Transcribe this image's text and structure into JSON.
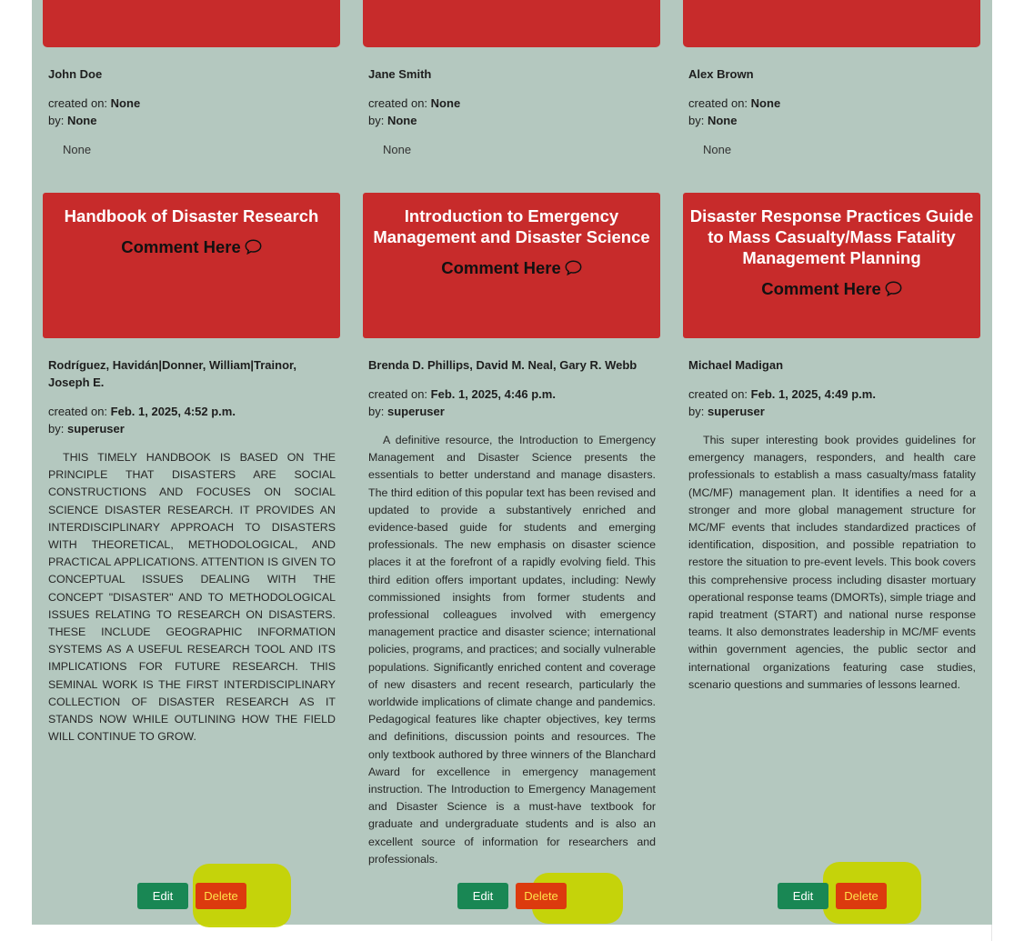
{
  "columns": [
    {
      "top_author": "John Doe",
      "top_created_label": "created on:",
      "top_created_value": "None",
      "top_by_label": "by:",
      "top_by_value": "None",
      "top_desc": "None",
      "title": "Handbook of Disaster Research",
      "comment_label": "Comment Here",
      "author": "Rodríguez, Havidán|Donner, William|Trainor, Joseph E.",
      "created_label": "created on:",
      "created_value": "Feb. 1, 2025, 4:52 p.m.",
      "by_label": "by:",
      "by_value": "superuser",
      "description": "THIS TIMELY HANDBOOK IS BASED ON THE PRINCIPLE THAT DISASTERS ARE SOCIAL CONSTRUCTIONS AND FOCUSES ON SOCIAL SCIENCE DISASTER RESEARCH. IT PROVIDES AN INTERDISCIPLINARY APPROACH TO DISASTERS WITH THEORETICAL, METHODOLOGICAL, AND PRACTICAL APPLICATIONS. ATTENTION IS GIVEN TO CONCEPTUAL ISSUES DEALING WITH THE CONCEPT \"DISASTER\" AND TO METHODOLOGICAL ISSUES RELATING TO RESEARCH ON DISASTERS. THESE INCLUDE GEOGRAPHIC INFORMATION SYSTEMS AS A USEFUL RESEARCH TOOL AND ITS IMPLICATIONS FOR FUTURE RESEARCH. THIS SEMINAL WORK IS THE FIRST INTERDISCIPLINARY COLLECTION OF DISASTER RESEARCH AS IT STANDS NOW WHILE OUTLINING HOW THE FIELD WILL CONTINUE TO GROW.",
      "edit_label": "Edit",
      "delete_label": "Delete"
    },
    {
      "top_author": "Jane Smith",
      "top_created_label": "created on:",
      "top_created_value": "None",
      "top_by_label": "by:",
      "top_by_value": "None",
      "top_desc": "None",
      "title": "Introduction to Emergency Management and Disaster Science",
      "comment_label": "Comment Here",
      "author": "Brenda D. Phillips, David M. Neal, Gary R. Webb",
      "created_label": "created on:",
      "created_value": "Feb. 1, 2025, 4:46 p.m.",
      "by_label": "by:",
      "by_value": "superuser",
      "description": "A definitive resource, the Introduction to Emergency Management and Disaster Science presents the essentials to better understand and manage disasters. The third edition of this popular text has been revised and updated to provide a substantively enriched and evidence-based guide for students and emerging professionals. The new emphasis on disaster science places it at the forefront of a rapidly evolving field. This third edition offers important updates, including: Newly commissioned insights from former students and professional colleagues involved with emergency management practice and disaster science; international policies, programs, and practices; and socially vulnerable populations. Significantly enriched content and coverage of new disasters and recent research, particularly the worldwide implications of climate change and pandemics. Pedagogical features like chapter objectives, key terms and definitions, discussion points and resources. The only textbook authored by three winners of the Blanchard Award for excellence in emergency management instruction. The Introduction to Emergency Management and Disaster Science is a must-have textbook for graduate and undergraduate students and is also an excellent source of information for researchers and professionals.",
      "edit_label": "Edit",
      "delete_label": "Delete"
    },
    {
      "top_author": "Alex Brown",
      "top_created_label": "created on:",
      "top_created_value": "None",
      "top_by_label": "by:",
      "top_by_value": "None",
      "top_desc": "None",
      "title": "Disaster Response Practices Guide to Mass Casualty/Mass Fatality Management Planning",
      "comment_label": "Comment Here",
      "author": "Michael Madigan",
      "created_label": "created on:",
      "created_value": "Feb. 1, 2025, 4:49 p.m.",
      "by_label": "by:",
      "by_value": "superuser",
      "description": "This super interesting book provides guidelines for emergency managers, responders, and health care professionals to establish a mass casualty/mass fatality (MC/MF) management plan. It identifies a need for a stronger and more global management structure for MC/MF events that includes standardized practices of identification, disposition, and possible repatriation to restore the situation to pre-event levels. This book covers this comprehensive process including disaster mortuary operational response teams (DMORTs), simple triage and rapid treatment (START) and national nurse response teams. It also demonstrates leadership in MC/MF events within government agencies, the public sector and international organizations featuring case studies, scenario questions and summaries of lessons learned.",
      "edit_label": "Edit",
      "delete_label": "Delete"
    }
  ],
  "colors": {
    "panel_bg": "#b4c8bf",
    "card_bg": "#c72b2b",
    "edit_bg": "#198754",
    "delete_bg": "#dc3a0e",
    "delete_text": "#ffe14a",
    "highlight": "#c6d400"
  },
  "icons": {
    "comment": "chat-bubble-icon"
  }
}
